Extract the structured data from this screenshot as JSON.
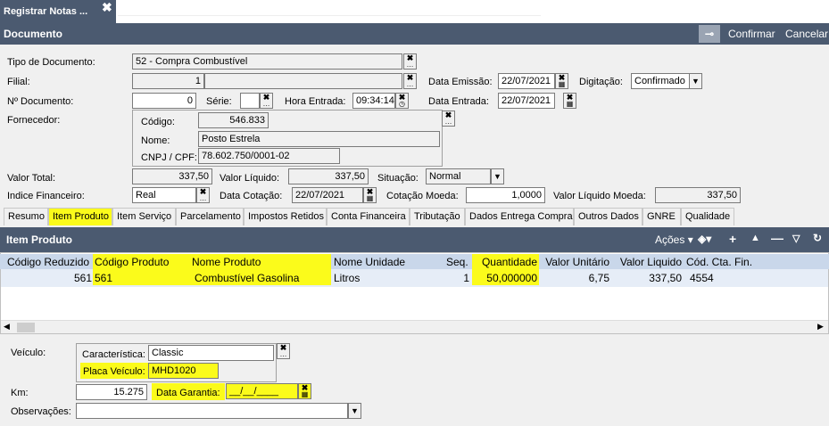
{
  "window_tab": {
    "title": "Registrar Notas ...",
    "close": "✖"
  },
  "header": {
    "title": "Documento",
    "confirm": "Confirmar",
    "cancel": "Cancelar"
  },
  "form": {
    "tipo_label": "Tipo de Documento:",
    "tipo_value": "52 - Compra Combustível",
    "filial_label": "Filial:",
    "filial_value": "1",
    "data_emissao_label": "Data Emissão:",
    "data_emissao_value": "22/07/2021",
    "digitacao_label": "Digitação:",
    "digitacao_value": "Confirmado",
    "num_doc_label": "Nº Documento:",
    "num_doc_value": "0",
    "serie_label": "Série:",
    "serie_value": "",
    "hora_entrada_label": "Hora Entrada:",
    "hora_entrada_value": "09:34:14",
    "data_entrada_label": "Data Entrada:",
    "data_entrada_value": "22/07/2021",
    "fornecedor_label": "Fornecedor:",
    "codigo_label": "Código:",
    "codigo_value": "546.833",
    "nome_label": "Nome:",
    "nome_value": "Posto Estrela",
    "cnpj_label": "CNPJ / CPF:",
    "cnpj_value": "78.602.750/0001-02",
    "valor_total_label": "Valor Total:",
    "valor_total_value": "337,50",
    "valor_liquido_label": "Valor Líquido:",
    "valor_liquido_value": "337,50",
    "situacao_label": "Situação:",
    "situacao_value": "Normal",
    "indice_label": "Indice Financeiro:",
    "indice_value": "Real",
    "data_cotacao_label": "Data Cotação:",
    "data_cotacao_value": "22/07/2021",
    "cotacao_moeda_label": "Cotação Moeda:",
    "cotacao_moeda_value": "1,0000",
    "vl_liq_moeda_label": "Valor Líquido Moeda:",
    "vl_liq_moeda_value": "337,50"
  },
  "tabs": [
    "Resumo",
    "Item Produto",
    "Item Serviço",
    "Parcelamento",
    "Impostos Retidos",
    "Conta Financeira",
    "Tributação",
    "Dados Entrega Compra",
    "Outros Dados",
    "GNRE",
    "Qualidade"
  ],
  "grid": {
    "title": "Item Produto",
    "acoes": "Ações",
    "columns": [
      "Código Reduzido",
      "Código Produto",
      "Nome Produto",
      "Nome Unidade",
      "Seq.",
      "Quantidade",
      "Valor Unitário",
      "Valor Liquido",
      "Cód. Cta. Fin."
    ],
    "rows": [
      [
        "561",
        "561",
        "Combustível Gasolina",
        "Litros",
        "1",
        "50,000000",
        "6,75",
        "337,50",
        "4554"
      ]
    ]
  },
  "bottom": {
    "veiculo_label": "Veículo:",
    "caracteristica_label": "Característica:",
    "caracteristica_value": "Classic",
    "placa_label": "Placa Veículo:",
    "placa_value": "MHD1020",
    "km_label": "Km:",
    "km_value": "15.275",
    "data_garantia_label": "Data Garantia:",
    "data_garantia_value": "__/__/____",
    "observacoes_label": "Observações:",
    "observacoes_value": ""
  },
  "colors": {
    "header_bar": "#4b5a70",
    "highlight": "#fbfb1b",
    "grid_header": "#c9d7ea",
    "grid_row": "#e6edf7"
  }
}
